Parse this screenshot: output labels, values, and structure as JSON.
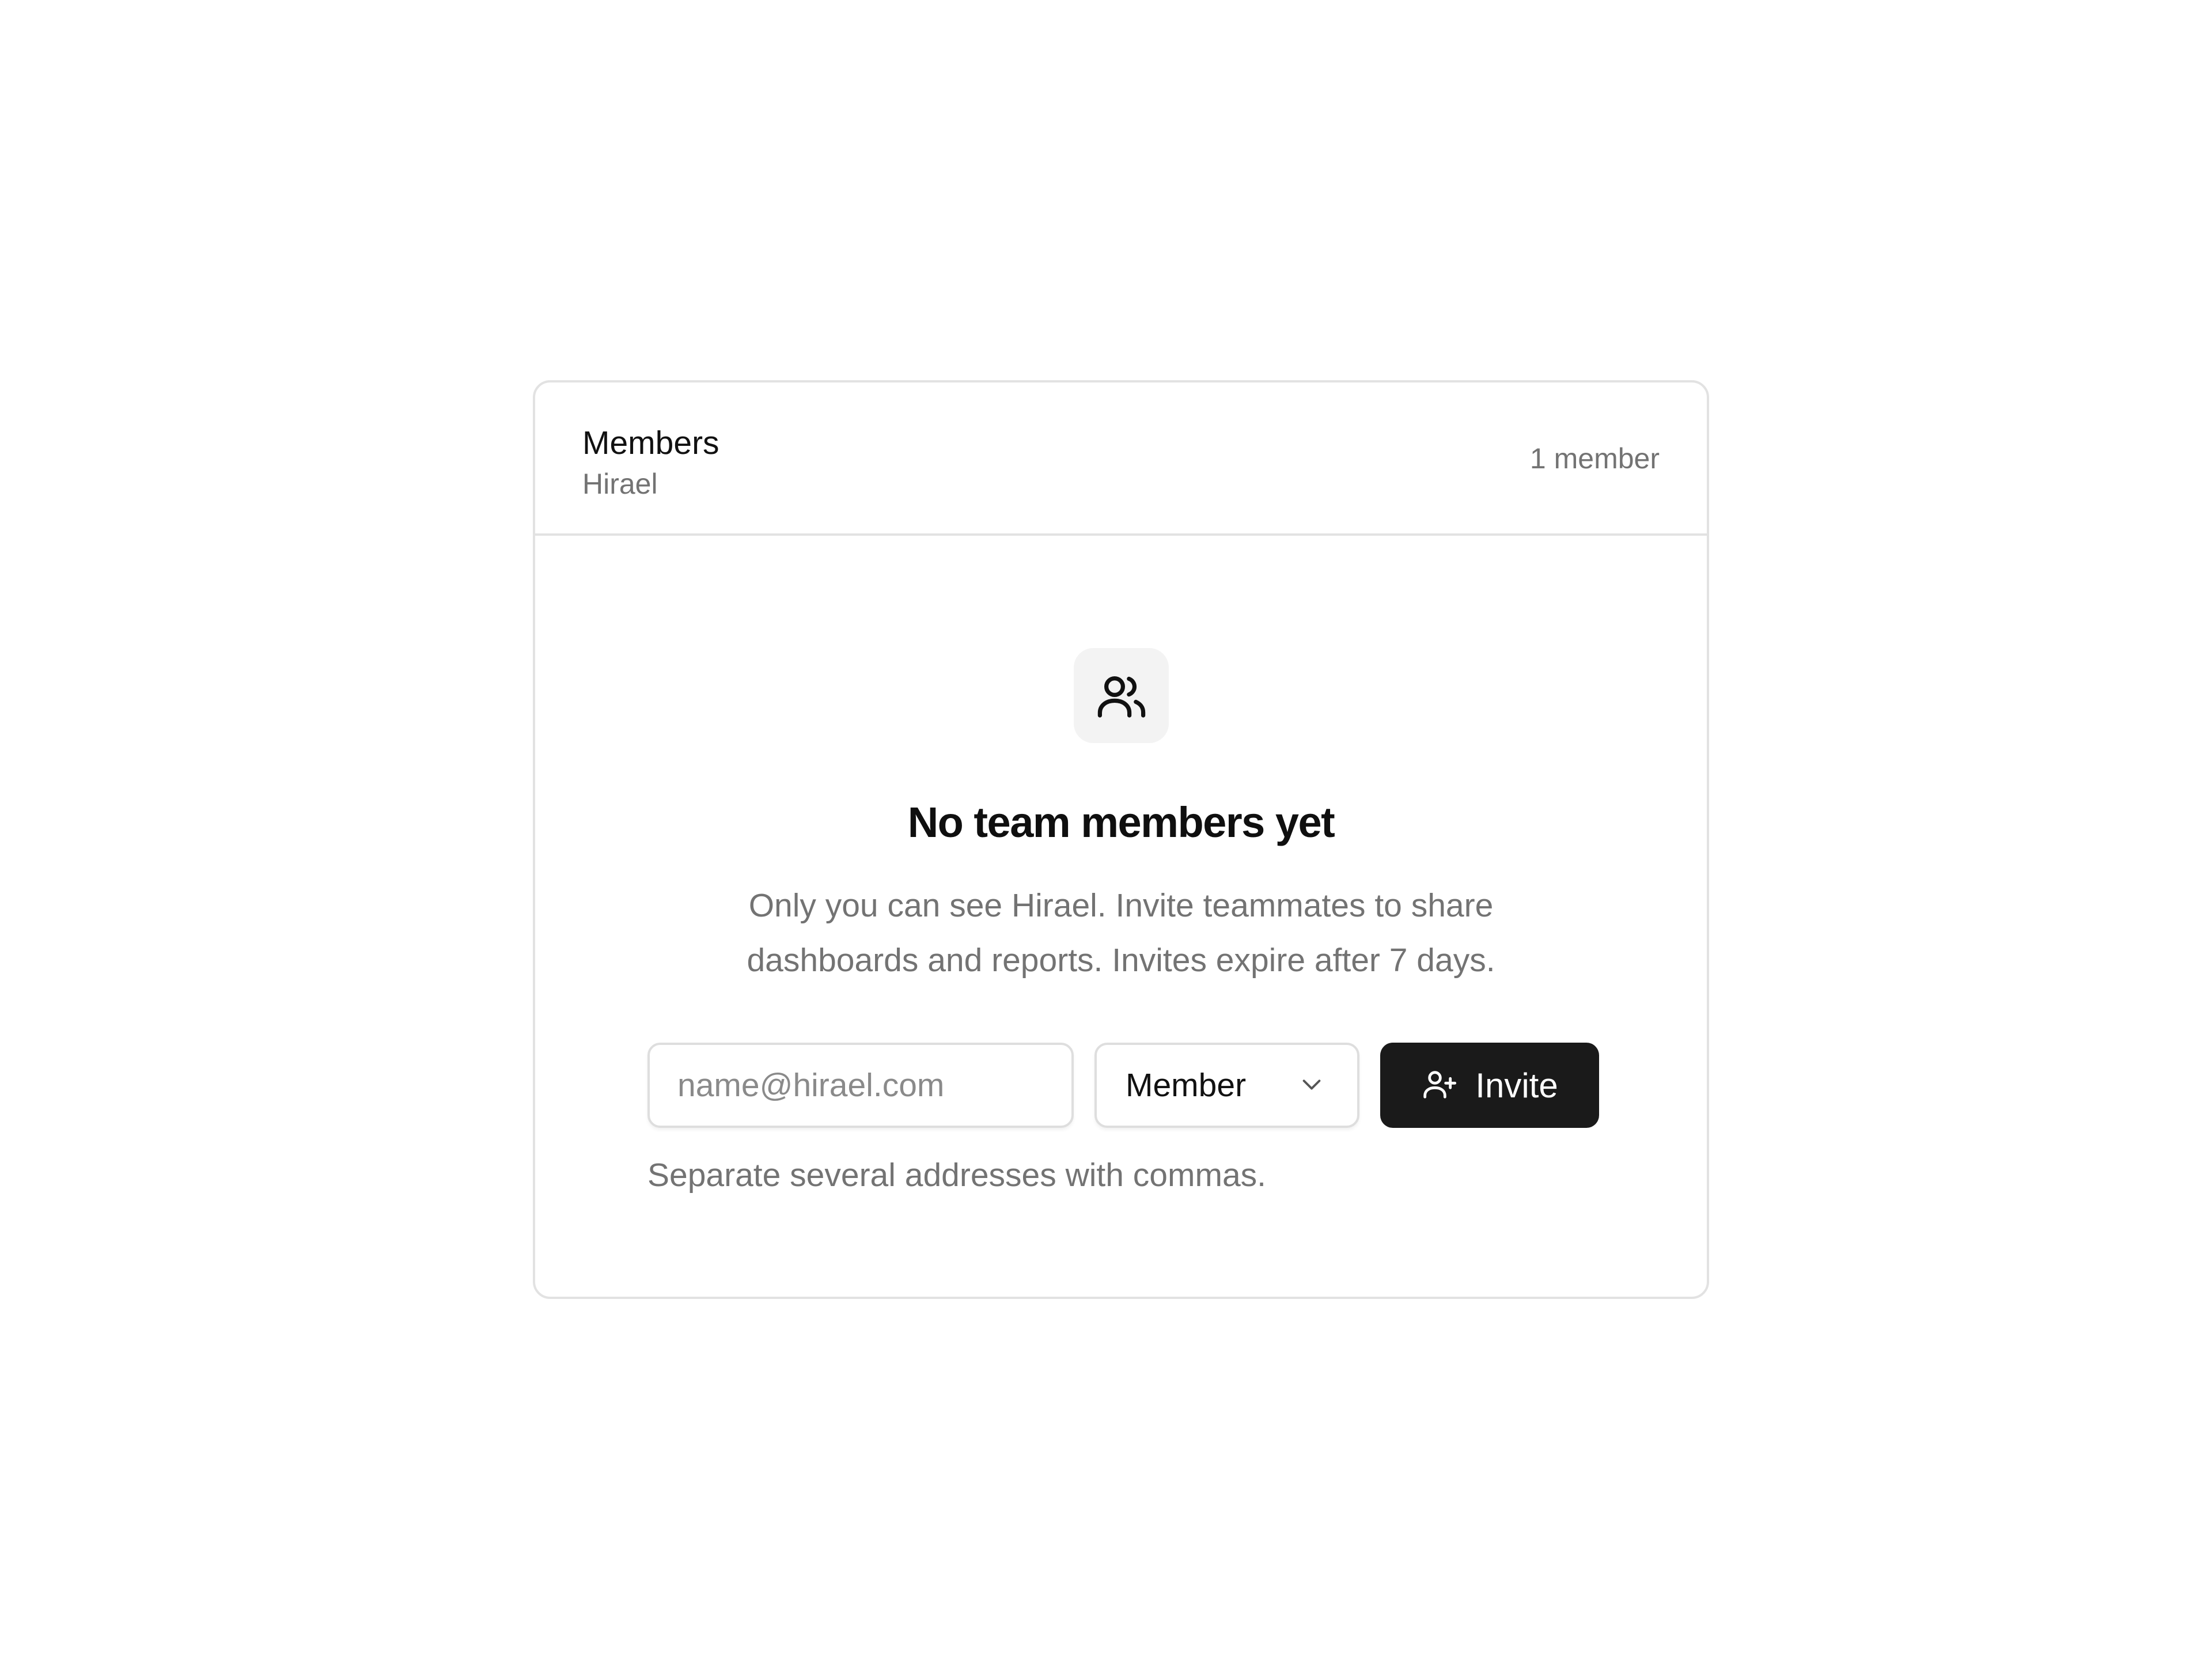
{
  "header": {
    "title": "Members",
    "subtitle": "Hirael",
    "member_count": "1 member"
  },
  "empty_state": {
    "icon": "users-icon",
    "title": "No team members yet",
    "description": "Only you can see Hirael. Invite teammates to share dashboards and reports. Invites expire after 7 days."
  },
  "invite_form": {
    "email_placeholder": "name@hirael.com",
    "email_value": "",
    "role_selected": "Member",
    "role_icon": "chevron-down-icon",
    "invite_label": "Invite",
    "invite_icon": "user-plus-icon",
    "helper_text": "Separate several addresses with commas."
  },
  "colors": {
    "button_background": "#1a1a1a",
    "muted_text": "#737373",
    "border": "#e2e2e2",
    "icon_tile": "#f3f3f3"
  }
}
